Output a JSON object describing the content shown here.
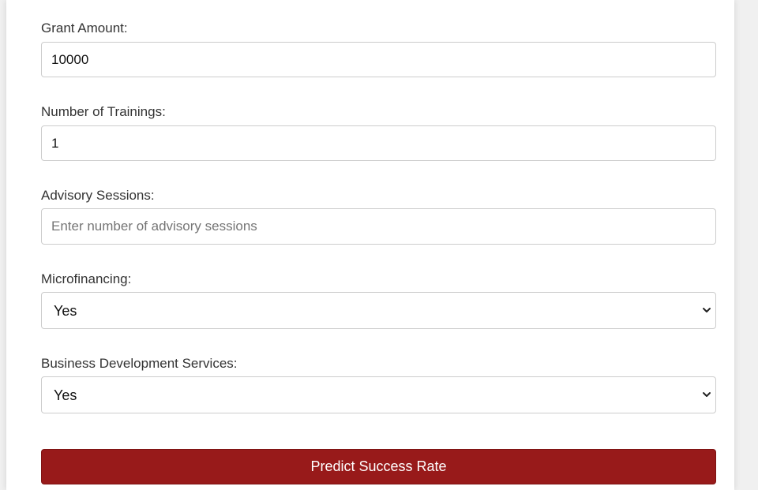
{
  "form": {
    "grant_amount": {
      "label": "Grant Amount:",
      "value": "10000"
    },
    "trainings": {
      "label": "Number of Trainings:",
      "value": "1"
    },
    "advisory": {
      "label": "Advisory Sessions:",
      "value": "",
      "placeholder": "Enter number of advisory sessions"
    },
    "microfinancing": {
      "label": "Microfinancing:",
      "selected": "Yes",
      "icon": "chevron-down-icon"
    },
    "bds": {
      "label": "Business Development Services:",
      "selected": "Yes",
      "icon": "chevron-down-icon"
    },
    "submit_label": "Predict Success Rate"
  },
  "colors": {
    "primary_button": "#981a1a",
    "input_border": "#cccccc",
    "page_background": "#f0f0f0"
  }
}
